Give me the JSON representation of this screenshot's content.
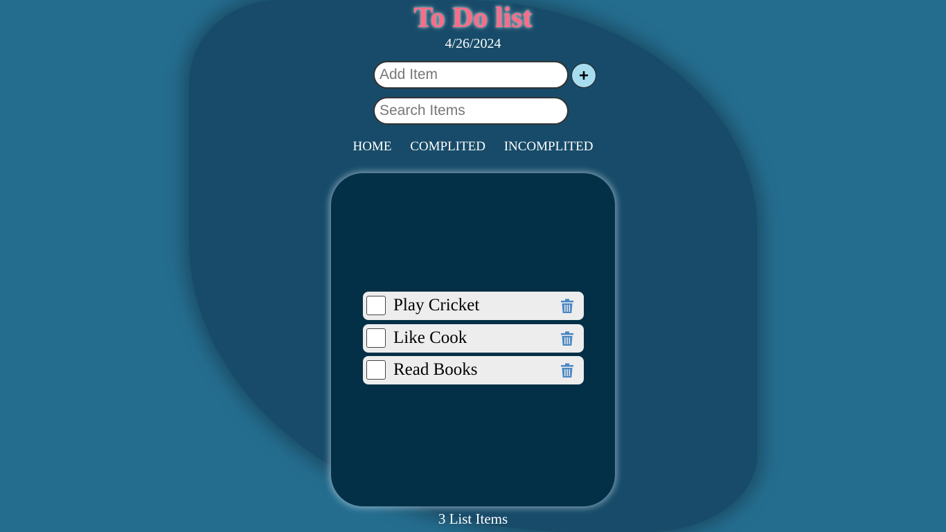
{
  "app": {
    "title": "To Do list",
    "date": "4/26/2024"
  },
  "add": {
    "placeholder": "Add Item",
    "value": "",
    "button_label": "+"
  },
  "search": {
    "placeholder": "Search Items",
    "value": ""
  },
  "nav": {
    "items": [
      {
        "label": "HOME"
      },
      {
        "label": "COMPLITED"
      },
      {
        "label": "INCOMPLITED"
      }
    ]
  },
  "list": {
    "items": [
      {
        "label": "Play Cricket",
        "checked": false,
        "icon": "trash-icon"
      },
      {
        "label": "Like Cook",
        "checked": false,
        "icon": "trash-icon"
      },
      {
        "label": "Read Books",
        "checked": false,
        "icon": "trash-icon"
      }
    ]
  },
  "footer": {
    "count_text": "3 List Items"
  },
  "colors": {
    "background": "#256d8f",
    "blob": "#174b69",
    "panel": "#033046",
    "title": "#ff6b86",
    "add_button": "#a7dcef",
    "trash_icon": "#4a86c5",
    "item_bg": "#ededed"
  }
}
